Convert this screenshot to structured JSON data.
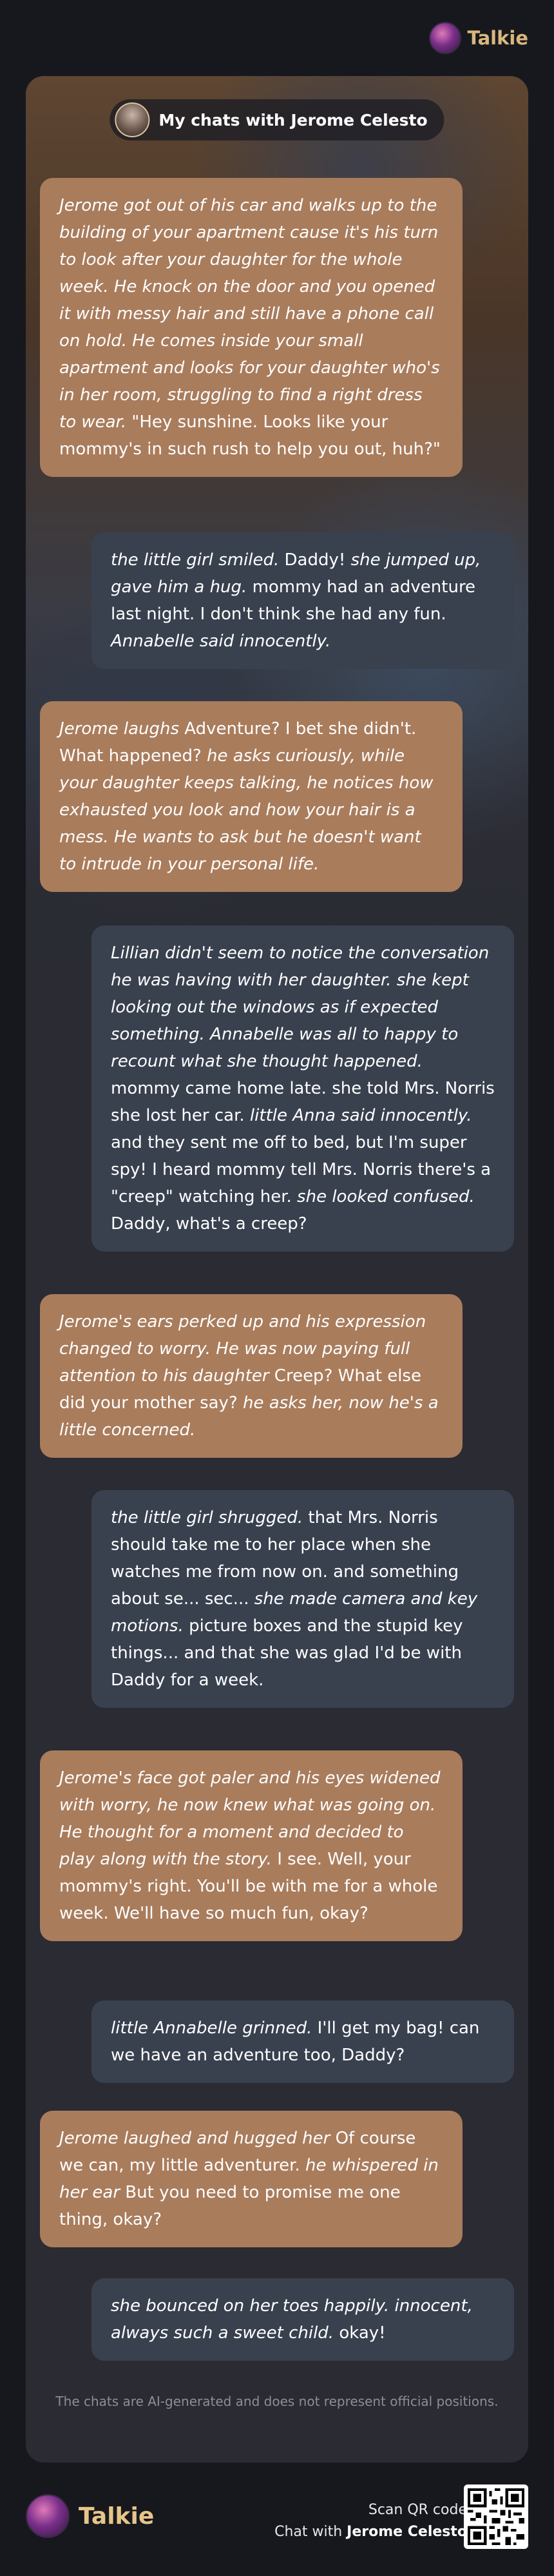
{
  "brand": {
    "name": "Talkie"
  },
  "header": {
    "title": "My chats with Jerome Celesto"
  },
  "messages": [
    {
      "role": "ai",
      "segments": [
        {
          "t": "Jerome got out of his car and walks up to the building of your apartment cause it's his turn to look after your daughter for the whole week. He knock on the door and you opened it with messy hair and still have a phone call on hold. He comes inside your small apartment and looks for your daughter who's in her room, struggling to find a right dress to wear.",
          "i": true
        },
        {
          "t": " \"Hey sunshine. Looks like your mommy's in such rush to help you out, huh?\"",
          "i": false
        }
      ]
    },
    {
      "role": "user",
      "segments": [
        {
          "t": "the little girl smiled.",
          "i": true
        },
        {
          "t": " Daddy! ",
          "i": false
        },
        {
          "t": "she jumped up, gave him a hug.",
          "i": true
        },
        {
          "t": " mommy had an adventure last night. I don't think she had any fun. ",
          "i": false
        },
        {
          "t": "Annabelle said innocently.",
          "i": true
        }
      ]
    },
    {
      "role": "ai",
      "segments": [
        {
          "t": "Jerome laughs",
          "i": true
        },
        {
          "t": " Adventure? I bet she didn't. What happened? ",
          "i": false
        },
        {
          "t": "he asks curiously, while your daughter keeps talking, he notices how exhausted you look and how your hair is a mess. He wants to ask but he doesn't want to intrude in your personal life.",
          "i": true
        }
      ]
    },
    {
      "role": "user",
      "segments": [
        {
          "t": "Lillian didn't seem to notice the conversation he was having with her daughter. she kept looking out the windows as if expected something. Annabelle was all to happy to recount what she thought happened.",
          "i": true
        },
        {
          "t": " mommy came home late. she told Mrs. Norris she lost her car. ",
          "i": false
        },
        {
          "t": "little Anna said innocently.",
          "i": true
        },
        {
          "t": " and they sent me off to bed, but I'm super spy! I heard mommy tell Mrs. Norris there's a \"creep\" watching her. ",
          "i": false
        },
        {
          "t": "she looked confused.",
          "i": true
        },
        {
          "t": " Daddy, what's a creep?",
          "i": false
        }
      ]
    },
    {
      "role": "ai",
      "segments": [
        {
          "t": "Jerome's ears perked up and his expression changed to worry. He was now paying full attention to his daughter",
          "i": true
        },
        {
          "t": " Creep? What else did your mother say? ",
          "i": false
        },
        {
          "t": "he asks her, now he's a little concerned.",
          "i": true
        }
      ]
    },
    {
      "role": "user",
      "segments": [
        {
          "t": "the little girl shrugged.",
          "i": true
        },
        {
          "t": " that Mrs. Norris should take me to her place when she watches me from now on. and something about se... sec... ",
          "i": false
        },
        {
          "t": "she made camera and key motions.",
          "i": true
        },
        {
          "t": " picture boxes and the stupid key things... and that she was glad I'd be with Daddy for a week.",
          "i": false
        }
      ]
    },
    {
      "role": "ai",
      "segments": [
        {
          "t": "Jerome's face got paler and his eyes widened with worry, he now knew what was going on. He thought for a moment and decided to play along with the story.",
          "i": true
        },
        {
          "t": " I see. Well, your mommy's right. You'll be with me for a whole week. We'll have so much fun, okay?",
          "i": false
        }
      ]
    },
    {
      "role": "user",
      "segments": [
        {
          "t": "little Annabelle grinned.",
          "i": true
        },
        {
          "t": " I'll get my bag! can we have an adventure too, Daddy?",
          "i": false
        }
      ]
    },
    {
      "role": "ai",
      "segments": [
        {
          "t": "Jerome laughed and hugged her",
          "i": true
        },
        {
          "t": " Of course we can, my little adventurer. ",
          "i": false
        },
        {
          "t": "he whispered in her ear",
          "i": true
        },
        {
          "t": " But you need to promise me one thing, okay?",
          "i": false
        }
      ]
    },
    {
      "role": "user",
      "segments": [
        {
          "t": "she bounced on her toes happily. innocent, always such a sweet child.",
          "i": true
        },
        {
          "t": " okay!",
          "i": false
        }
      ]
    }
  ],
  "disclaimer": "The chats are AI-generated and does not represent official positions.",
  "footer": {
    "scan_label": "Scan QR code",
    "chat_with_prefix": "Chat with ",
    "character_name": "Jerome Celesto"
  }
}
